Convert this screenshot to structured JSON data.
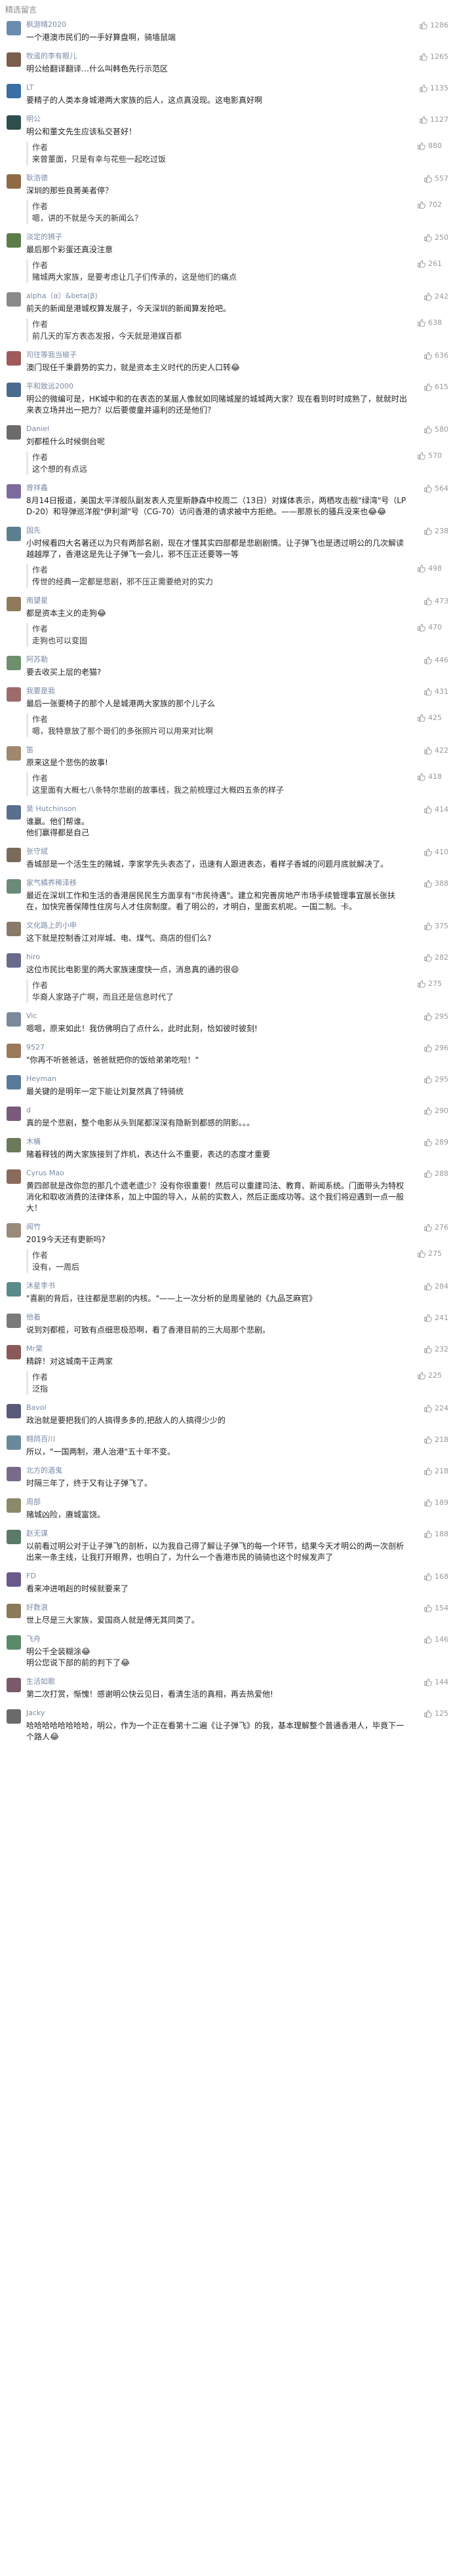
{
  "header": {
    "title": "精选留言"
  },
  "comments": [
    {
      "nick": "枫游晴2020",
      "likes": "1286",
      "text": "一个港澳市民们的一手好算盘啊，骑墙鼠端",
      "color": "#6a8caf"
    },
    {
      "nick": "牧遥的李有眼儿",
      "likes": "1265",
      "text": "明公给翻译翻译…什么叫韩色先行示范区",
      "color": "#7b5e4b"
    },
    {
      "nick": "LT",
      "likes": "1135",
      "text": "要精子的人类本身城港两大家族的后人，这点真没现。这电影真好啊",
      "color": "#3a6ea5"
    },
    {
      "nick": "明公",
      "likes": "1127",
      "text": "明公和董文先生应该私交甚好！",
      "color": "#2f4f4f",
      "reply": {
        "label": "作者",
        "likes": "880",
        "text": "来曾董面，只是有幸与花些一起吃过饭"
      }
    },
    {
      "nick": "耿浩德",
      "likes": "557",
      "text": "深圳的那些良莠美者停？",
      "color": "#8f6a45",
      "reply": {
        "label": "作者",
        "likes": "702",
        "text": "嗯，讲的不就是今天的新闻么？"
      }
    },
    {
      "nick": "淡定的狮子",
      "likes": "250",
      "text": "最后那个彩蛋还真没注意",
      "color": "#5a7d4a",
      "reply": {
        "label": "作者",
        "likes": "261",
        "text": "赌城两大家族，是要考虑让几子们传承的，这是他们的痛点"
      }
    },
    {
      "nick": "alpha（α）&beta(β)",
      "likes": "242",
      "text": "前天的新闻是港城权算发展子，今天深圳的新闻算发抢吧。",
      "color": "#8a8a8a",
      "reply": {
        "label": "作者",
        "likes": "638",
        "text": "前几天的军方表态发报，今天就是港媒百都"
      }
    },
    {
      "nick": "司往等我当椒子",
      "likes": "636",
      "text": "澳门现任千秉爵势的实力，就是资本主义时代的历史人口转😂",
      "color": "#a05a5a"
    },
    {
      "nick": "平和致远2000",
      "likes": "615",
      "text": "明公的微编可是，HK城中和的在表态的某届人像就如同赌城屋的城城两大家？现在看到时时成熟了，就就时出来表立场并出一把力？以后要傻童并逼利的还是他们？",
      "color": "#4b6a8f"
    },
    {
      "nick": "Daniel",
      "likes": "580",
      "text": "刘都榄什么时候倒台呢",
      "color": "#6b6b6b",
      "reply": {
        "label": "作者",
        "likes": "570",
        "text": "这个想的有点远"
      }
    },
    {
      "nick": "曾祥鑫",
      "likes": "564",
      "text": "8月14日报道，美国太平洋舰队副发表人克里斯静森中校周二（13日）对媒体表示，两栖攻击舰\"绿湾\"号（LPD-20）和导弹巡洋舰\"伊利湖\"号（CG-70）访问香港的请求被中方拒绝。——那原长的骚兵没来也😂😂",
      "color": "#7d6b9e"
    },
    {
      "nick": "国先",
      "likes": "238",
      "text": "小时候看四大名著还以为只有两部名剧，现在才懂其实四部都是悲剧剧情。让子弹飞也是透过明公的几次解读越越厚了，香港这是先让子弹飞一会儿，邪不压正还要等一等",
      "color": "#5e7f8f",
      "reply": {
        "label": "作者",
        "likes": "498",
        "text": "传世的经典一定都是悲剧，邪不压正需要绝对的实力"
      }
    },
    {
      "nick": "南望星",
      "likes": "473",
      "text": "都是资本主义的走狗😂",
      "color": "#8f7a5e",
      "reply": {
        "label": "作者",
        "likes": "470",
        "text": "走狗也可以变固"
      }
    },
    {
      "nick": "阿苏勒",
      "likes": "446",
      "text": "要去收买上层的老猫?",
      "color": "#6f8f6f"
    },
    {
      "nick": "我要是我",
      "likes": "431",
      "text": "最后一张要椅子的那个人是城港两大家族的那个儿子么",
      "color": "#9e6b6b",
      "reply": {
        "label": "作者",
        "likes": "425",
        "text": "嗯，我特意放了那个哥们的多张照片可以用来对比啊"
      }
    },
    {
      "nick": "笛",
      "likes": "422",
      "text": "原来这是个悲伤的故事!",
      "color": "#a0886e",
      "reply": {
        "label": "作者",
        "likes": "418",
        "text": "这里面有大概七八条特尔悲剧的故事线，我之前梳理过大概四五条的样子"
      }
    },
    {
      "nick": "昊 Hutchinson",
      "likes": "414",
      "text": "谁赢。他们帮谁。\n他们赢得都是自己",
      "color": "#5a6e8f"
    },
    {
      "nick": "张守斌",
      "likes": "410",
      "text": "香城部是一个活生生的赌城，李家学先头表态了，迅速有人跟进表态，看样子香城的问题月底就解决了。",
      "color": "#7a6a5a"
    },
    {
      "nick": "家气橘养稀泽移",
      "likes": "388",
      "text": "最近在深圳工作和生活的香港居民民生方面享有\"市民待遇\"。建立和完善房地产市场手续管理事宜展长张扶在，加快完善保障性住房与人才住房制度。看了明公的，才明白，里面玄机呢。一国二制。卡。",
      "color": "#6a8a7a"
    },
    {
      "nick": "文化路上的小申",
      "likes": "375",
      "text": "这下就是控制香江对岸城、电、煤气、商店的但们么?",
      "color": "#8a7a6a"
    },
    {
      "nick": "hiro",
      "likes": "282",
      "text": "这位市民比电影里的两大家族速度快一点，消息真的通的很😄",
      "color": "#6a6a8a",
      "reply": {
        "label": "作者",
        "likes": "275",
        "text": "华裔人家路子广啊，而且还是信息时代了"
      }
    },
    {
      "nick": "Vic",
      "likes": "295",
      "text": "嗯嗯，原来如此！我仿佛明白了点什么，此时此刻，恰如彼时彼刻!",
      "color": "#7a8a9a"
    },
    {
      "nick": "9527",
      "likes": "296",
      "text": "\"你再不听爸爸话，爸爸就把你的饭给弟弟吃啦！\"",
      "color": "#9a7a5a"
    },
    {
      "nick": "Heyman",
      "likes": "295",
      "text": "最关键的是明年一定下能让刘复然真了特骑统",
      "color": "#5a7a9a"
    },
    {
      "nick": "d",
      "likes": "290",
      "text": "真的是个悲剧，整个电影从头到尾都深深有隐新到都感的阴影。。。",
      "color": "#7a5a7a"
    },
    {
      "nick": "木桶",
      "likes": "289",
      "text": "赌着释钱的两大家族接到了炸机，表达什么不重要，表达的态度才重要",
      "color": "#6a7a5a"
    },
    {
      "nick": "Cyrus Mao",
      "likes": "288",
      "text": "黄四郎就是改你忽的那几个遗老遗少？没有你很重要！然后可以重建司法、教育、新闻系统。门面带头为特权消化和取收消费的法律体系，加上中国的导入，从前的实数人，然后正面成功等。这个我们将迎遇到一点一般大！",
      "color": "#8a6a5a"
    },
    {
      "nick": "闻竹",
      "likes": "276",
      "text": "2019今天还有更新吗?",
      "color": "#9a8a7a",
      "reply": {
        "label": "作者",
        "likes": "275",
        "text": "没有，一周后"
      }
    },
    {
      "nick": "沐星李书",
      "likes": "284",
      "text": "\"喜剧的背后，往往都是悲剧的内核。\"——上一次分析的是周星驰的《九品芝麻官》",
      "color": "#5a8a8a"
    },
    {
      "nick": "他着",
      "likes": "241",
      "text": "说到刘都榄，可致有点细思极恐啊，看了香港目前的三大局那个悲剧。",
      "color": "#7a7a7a"
    },
    {
      "nick": "Mr棠",
      "likes": "232",
      "text": "精辟！对这城南干正两家",
      "color": "#8a5a5a",
      "reply": {
        "label": "作者",
        "likes": "225",
        "text": "泛指"
      }
    },
    {
      "nick": "Bavol",
      "likes": "224",
      "text": "政治就是要把我们的人搞得多多的,把敌人的人搞得少少的",
      "color": "#5a5a7a"
    },
    {
      "nick": "翱鸽百川",
      "likes": "218",
      "text": "所以，\"一国两制，港人治港\"五十年不变。",
      "color": "#6a8a9a"
    },
    {
      "nick": "北方的酒鬼",
      "likes": "218",
      "text": "时隔三年了，终于又有让子弹飞了。",
      "color": "#7a6a8a"
    },
    {
      "nick": "周部",
      "likes": "189",
      "text": "赌城凶险，赓城富饶。",
      "color": "#8a8a6a"
    },
    {
      "nick": "赵无谋",
      "likes": "188",
      "text": "以前看过明公对于让子弹飞的剖析，以为我自己得了解让子弹飞的每一个环节，结果今天才明公的两一次剖析出来一条主线，让我打开眼界，也明白了，为什么一个香港市民的骑骑也这个时候发声了",
      "color": "#5a7a6a"
    },
    {
      "nick": "FD",
      "likes": "168",
      "text": "看来冲进哨赳的时候就要来了",
      "color": "#6a5a8a"
    },
    {
      "nick": "好数浪",
      "likes": "154",
      "text": "世上尽是三大家族，爱国商人就是傅无其同类了。",
      "color": "#8a7a5a"
    },
    {
      "nick": "飞舟",
      "likes": "146",
      "text": "明公千全装糊涂😂\n明公您说下部的前的判下了😂",
      "color": "#5a8a6a"
    },
    {
      "nick": "生活如歌",
      "likes": "144",
      "text": "第二次打赏，惭愧！感谢明公快云见日，看清生活的真相，再去热爱他!",
      "color": "#7a5a6a"
    },
    {
      "nick": "Jacky",
      "likes": "125",
      "text": "哈哈哈哈哈哈哈哈，明公，作为一个正在看第十二遍《让子弹飞》的我，基本理解整个普通香港人，毕竟下一个路人😂",
      "color": "#6a6a6a"
    }
  ]
}
